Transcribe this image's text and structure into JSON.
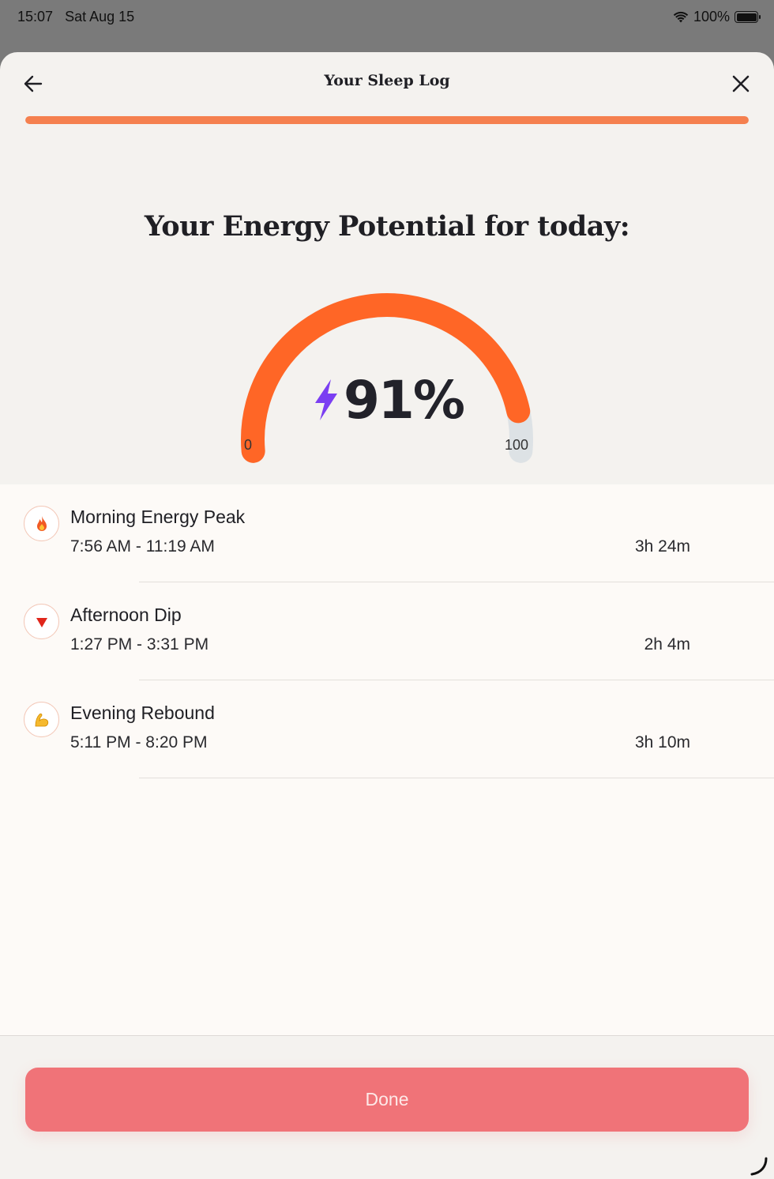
{
  "status_bar": {
    "time": "15:07",
    "date": "Sat Aug 15",
    "battery": "100%"
  },
  "nav": {
    "title": "Your Sleep Log",
    "back_icon": "arrow-left-icon",
    "close_icon": "close-icon"
  },
  "progress": {
    "value": 1.0
  },
  "heading": "Your Energy Potential for today:",
  "gauge": {
    "value": 91,
    "display": "91%",
    "min_label": "0",
    "max_label": "100",
    "icon": "lightning-bolt-icon"
  },
  "periods": [
    {
      "icon": "fire-icon",
      "title": "Morning Energy Peak",
      "time": "7:56 AM - 11:19 AM",
      "duration": "3h 24m"
    },
    {
      "icon": "red-triangle-down-icon",
      "title": "Afternoon Dip",
      "time": "1:27 PM - 3:31 PM",
      "duration": "2h 4m"
    },
    {
      "icon": "flexed-biceps-icon",
      "title": "Evening Rebound",
      "time": "5:11 PM - 8:20 PM",
      "duration": "3h 10m"
    }
  ],
  "footer": {
    "done_label": "Done"
  },
  "colors": {
    "accent": "#f5804f",
    "gauge_fill": "#ff6626",
    "gauge_track": "#dde2e5",
    "bolt": "#7b3ff2",
    "done_button": "#f07378"
  }
}
